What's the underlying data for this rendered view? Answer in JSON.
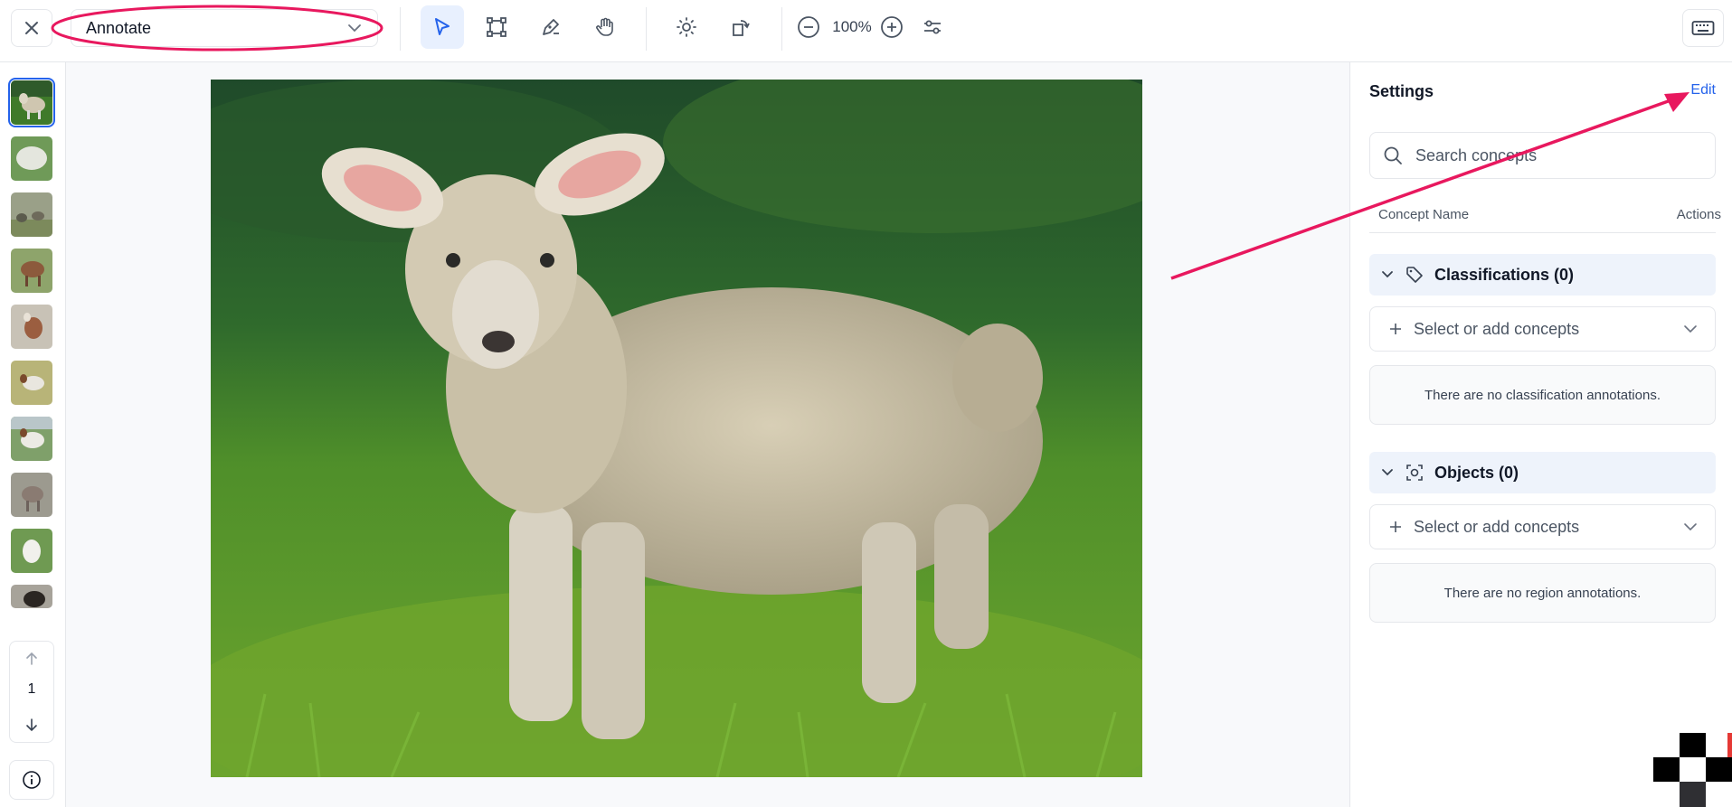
{
  "toolbar": {
    "mode_label": "Annotate",
    "zoom": "100%",
    "tools": [
      "select-tool",
      "bounding-box-tool",
      "polygon-pen-tool",
      "pan-hand-tool",
      "brightness-tool",
      "rotate-tool",
      "zoom-out",
      "zoom-in",
      "adjustments"
    ]
  },
  "leftbar": {
    "page_number": "1",
    "thumbnails": [
      "lamb",
      "white-sheep",
      "goats-group",
      "brown-goat",
      "brown-goat-standing",
      "goat-white-brown",
      "white-goat",
      "grey-goat",
      "white-goat-standing",
      "black-goat"
    ]
  },
  "settings": {
    "title": "Settings",
    "edit_label": "Edit",
    "search_placeholder": "Search concepts",
    "col_concept_name": "Concept Name",
    "col_actions": "Actions",
    "classifications": {
      "label": "Classifications (0)",
      "select_label": "Select or add concepts",
      "empty_text": "There are no classification annotations."
    },
    "objects": {
      "label": "Objects (0)",
      "select_label": "Select or add concepts",
      "empty_text": "There are no region annotations."
    }
  },
  "colors": {
    "accent": "#2563eb",
    "annotation_red": "#e8185e",
    "section_bg": "#eef3fb"
  }
}
